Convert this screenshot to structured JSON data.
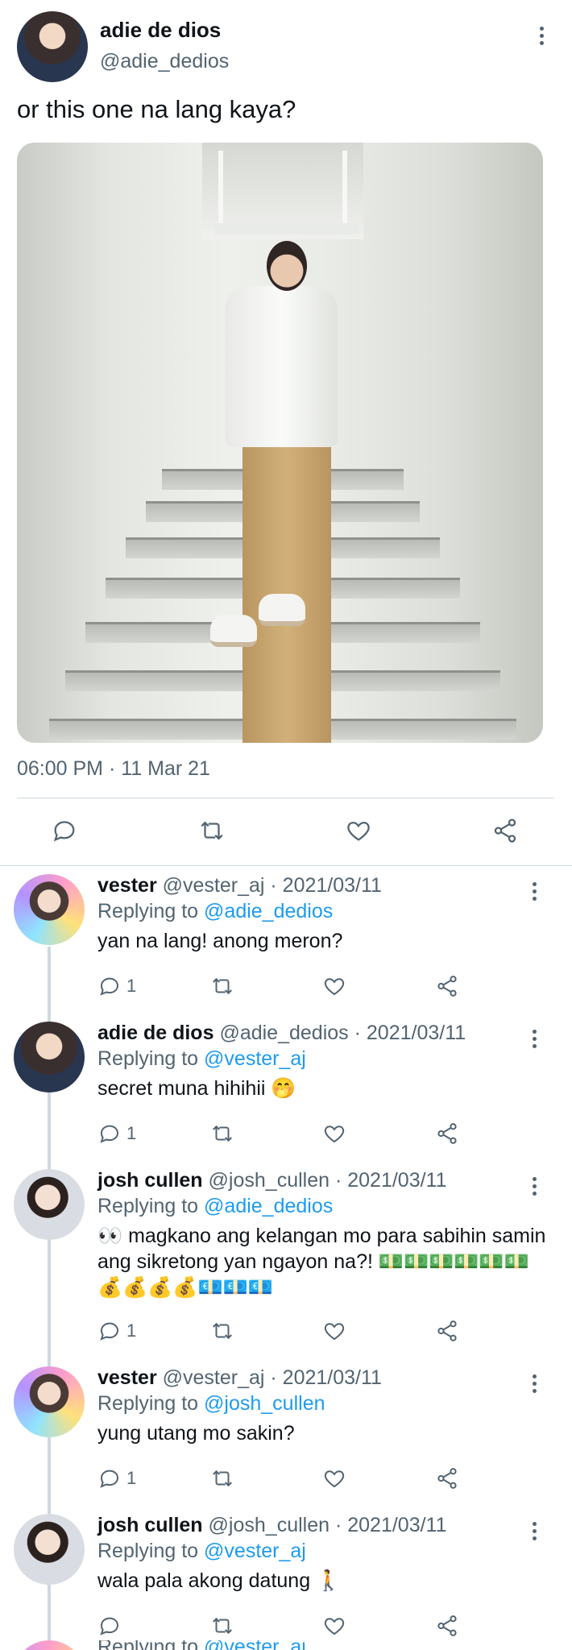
{
  "main_tweet": {
    "display_name": "adie de dios",
    "handle": "@adie_dedios",
    "text": "or this one na lang kaya?",
    "timestamp": "06:00 PM · 11 Mar 21",
    "image_alt": "person standing on a staircase"
  },
  "replies": [
    {
      "name": "vester",
      "handle": "@vester_aj",
      "date": "· 2021/03/11",
      "replying_label": "Replying to",
      "replying_to": "@adie_dedios",
      "text": "yan na lang! anong meron?",
      "reply_count": "1",
      "avatar": "vester"
    },
    {
      "name": "adie de dios",
      "handle": "@adie_dedios",
      "date": "· 2021/03/11",
      "replying_label": "Replying to",
      "replying_to": "@vester_aj",
      "text": "secret muna hihihii 🤭",
      "reply_count": "1",
      "avatar": "adie"
    },
    {
      "name": "josh cullen",
      "handle": "@josh_cullen",
      "date": "· 2021/03/11",
      "replying_label": "Replying to",
      "replying_to": "@adie_dedios",
      "text": "👀 magkano ang kelangan mo para sabihin samin ang sikretong yan ngayon na?! 💵💵💵💵💵💵💰💰💰💰💶💶💶",
      "reply_count": "1",
      "avatar": "josh"
    },
    {
      "name": "vester",
      "handle": "@vester_aj",
      "date": "· 2021/03/11",
      "replying_label": "Replying to",
      "replying_to": "@josh_cullen",
      "text": "yung utang mo sakin?",
      "reply_count": "1",
      "avatar": "vester"
    },
    {
      "name": "josh cullen",
      "handle": "@josh_cullen",
      "date": "· 2021/03/11",
      "replying_label": "Replying to",
      "replying_to": "@vester_aj",
      "text": "wala pala akong datung 🚶",
      "reply_count": "",
      "avatar": "josh"
    }
  ],
  "partial_next": {
    "replying_label": "Replying to",
    "replying_to": "@vester_aj"
  },
  "icons": [
    "reply-icon",
    "retweet-icon",
    "like-icon",
    "share-icon",
    "more-icon"
  ],
  "colors": {
    "link": "#1d9bf0",
    "muted": "#536471",
    "text": "#0f1419",
    "divider": "#cfd9de"
  }
}
